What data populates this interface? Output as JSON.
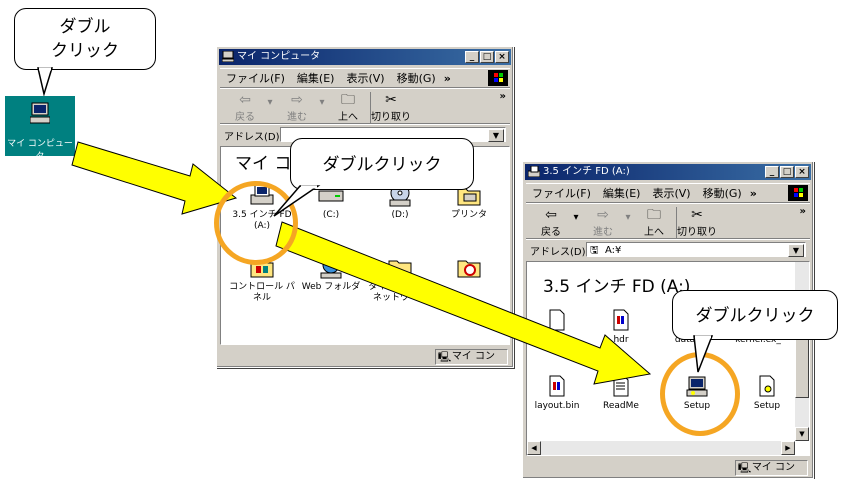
{
  "colors": {
    "arrow": "#ffff00",
    "highlight": "#f5a623",
    "titlebar": "#0a246a",
    "desktop_icon_bg": "#008080"
  },
  "desktop": {
    "icon_label": "マイ コンピュータ",
    "icon": "my-computer-icon"
  },
  "bubble1": {
    "line1": "ダブル",
    "line2": "クリック"
  },
  "bubble2": {
    "text": "ダブルクリック"
  },
  "bubble3": {
    "text": "ダブルクリック"
  },
  "window1": {
    "title": "マイ コンピュータ",
    "menu": [
      "ファイル(F)",
      "編集(E)",
      "表示(V)",
      "移動(G)"
    ],
    "menu_more": "»",
    "toolbar": {
      "back": "戻る",
      "forward": "進む",
      "up": "上へ",
      "cut": "切り取り",
      "more": "»"
    },
    "address_label": "アドレス(D)",
    "heading": "マイ コン",
    "items": [
      {
        "label": "3.5 インチ FD (A:)",
        "icon": "floppy-drive-icon"
      },
      {
        "label": "(C:)",
        "icon": "hard-drive-icon"
      },
      {
        "label": "(D:)",
        "icon": "cd-drive-icon"
      },
      {
        "label": "プリンタ",
        "icon": "printer-folder-icon"
      },
      {
        "label": "コントロール パネル",
        "icon": "control-panel-icon"
      },
      {
        "label": "Web フォルダ",
        "icon": "web-folder-icon"
      },
      {
        "label": "ダイヤルアップ ネットワーク",
        "icon": "dialup-network-icon"
      },
      {
        "label": "",
        "icon": "scheduled-tasks-icon"
      }
    ],
    "status": "マイ コン"
  },
  "window2": {
    "title": "3.5 インチ FD (A:)",
    "menu": [
      "ファイル(F)",
      "編集(E)",
      "表示(V)",
      "移動(G)"
    ],
    "menu_more": "»",
    "toolbar": {
      "back": "戻る",
      "forward": "進む",
      "up": "上へ",
      "cut": "切り取り",
      "more": "»"
    },
    "address_label": "アドレス(D)",
    "address_value": "A:¥",
    "heading": "3.5 インチ FD (A:)",
    "items": [
      {
        "label": "",
        "icon": "file-icon"
      },
      {
        "label": "hdr",
        "icon": "setup-file-icon"
      },
      {
        "label": "data",
        "icon": "file-icon"
      },
      {
        "label": "kernel.ex_",
        "icon": "file-icon"
      },
      {
        "label": "layout.bin",
        "icon": "setup-file-icon"
      },
      {
        "label": "ReadMe",
        "icon": "text-file-icon"
      },
      {
        "label": "Setup",
        "icon": "setup-computer-icon"
      },
      {
        "label": "Setup",
        "icon": "settings-file-icon"
      }
    ],
    "status": "マイ コン"
  }
}
